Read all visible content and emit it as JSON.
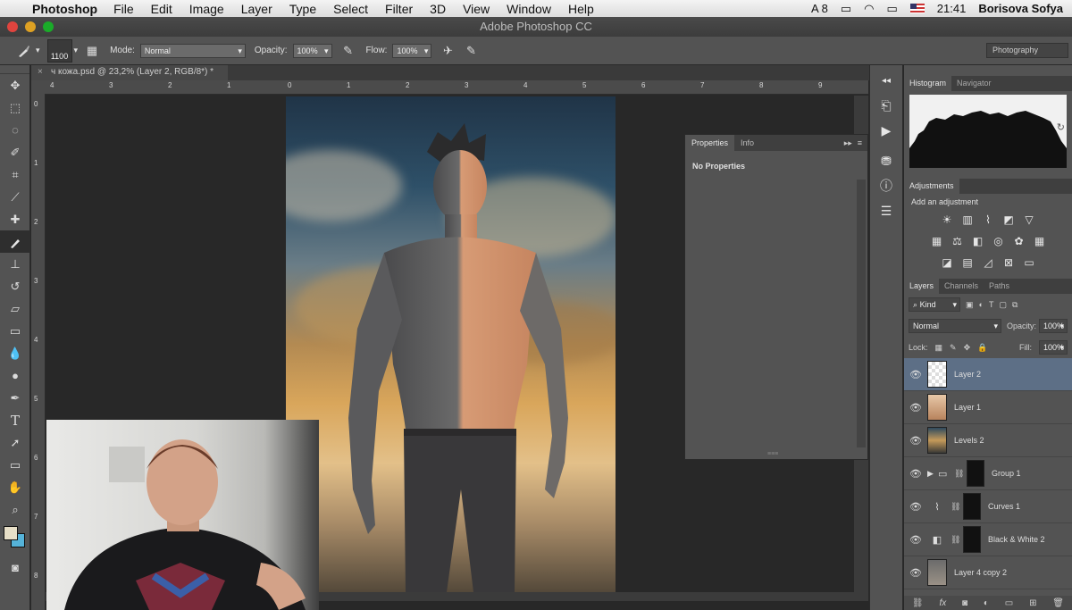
{
  "menubar": {
    "app_name": "Photoshop",
    "items": [
      "File",
      "Edit",
      "Image",
      "Layer",
      "Type",
      "Select",
      "Filter",
      "3D",
      "View",
      "Window",
      "Help"
    ],
    "adobe_count": "8",
    "time": "21:41",
    "user": "Borisova Sofya"
  },
  "window": {
    "title": "Adobe Photoshop CC"
  },
  "options": {
    "brush_size": "1100",
    "mode_label": "Mode:",
    "mode_value": "Normal",
    "opacity_label": "Opacity:",
    "opacity_value": "100%",
    "flow_label": "Flow:",
    "flow_value": "100%",
    "workspace": "Photography"
  },
  "document": {
    "tab_title": "ч кожа.psd @ 23,2% (Layer 2, RGB/8*) *",
    "hruler_labels": [
      "4",
      "3",
      "2",
      "1",
      "0",
      "1",
      "2",
      "3",
      "4",
      "5",
      "6",
      "7",
      "8",
      "9"
    ],
    "vruler_labels": [
      "0",
      "1",
      "2",
      "3",
      "4",
      "5",
      "6",
      "7",
      "8"
    ]
  },
  "properties_panel": {
    "tabs": [
      "Properties",
      "Info"
    ],
    "content": "No Properties"
  },
  "histogram_panel": {
    "tabs": [
      "Histogram",
      "Navigator"
    ]
  },
  "adjustments_panel": {
    "title": "Adjustments",
    "subtitle": "Add an adjustment"
  },
  "layers_panel": {
    "tabs": [
      "Layers",
      "Channels",
      "Paths"
    ],
    "filter_kind": "Kind",
    "blend_mode": "Normal",
    "opacity_label": "Opacity:",
    "opacity_value": "100%",
    "lock_label": "Lock:",
    "fill_label": "Fill:",
    "fill_value": "100%",
    "layers": [
      {
        "name": "Layer 2",
        "selected": true
      },
      {
        "name": "Layer 1",
        "selected": false
      },
      {
        "name": "Levels 2",
        "selected": false
      },
      {
        "name": "Group 1",
        "selected": false
      },
      {
        "name": "Curves 1",
        "selected": false
      },
      {
        "name": "Black & White 2",
        "selected": false
      },
      {
        "name": "Layer 4 copy 2",
        "selected": false
      }
    ]
  },
  "colors": {
    "foreground": "#e7dfc7",
    "background": "#55b3d9",
    "selected_layer": "#5d6f86",
    "panel_bg": "#535353"
  }
}
